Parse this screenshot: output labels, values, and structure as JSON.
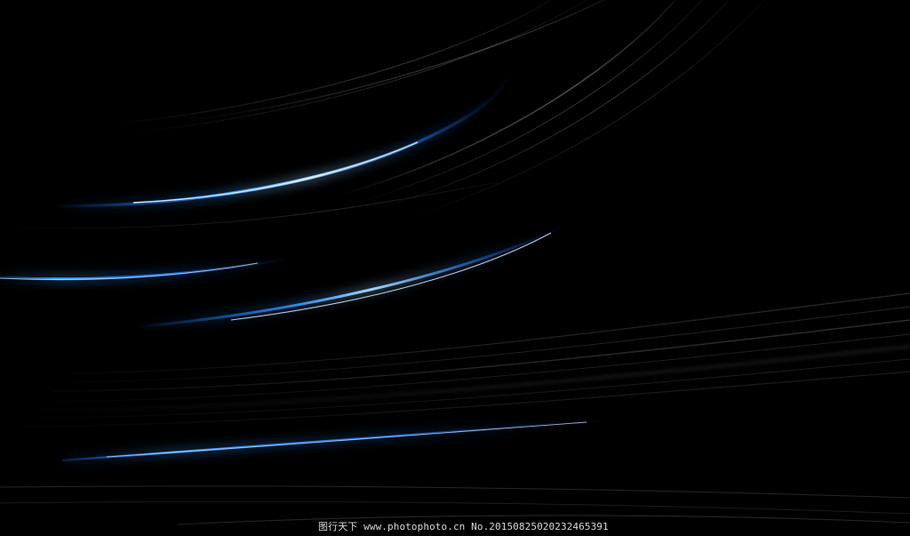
{
  "image": {
    "description_colors": {
      "background": "#000000",
      "blue_accent": "#1f8fff",
      "silver_streak": "#cfd6df"
    }
  },
  "watermark": {
    "text": "图行天下 www.photophoto.cn No.20150825020232465391"
  }
}
